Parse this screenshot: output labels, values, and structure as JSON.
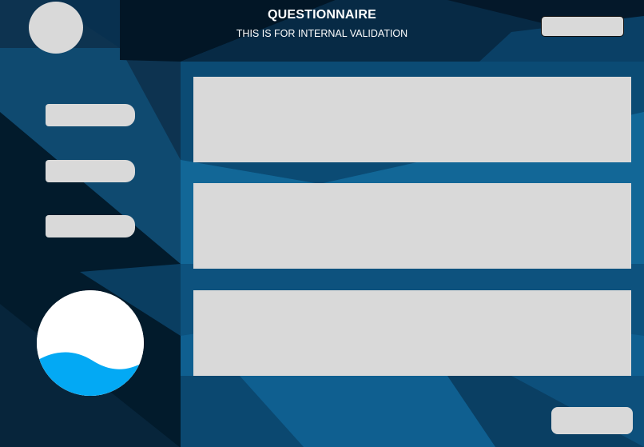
{
  "header": {
    "title": "QUESTIONNAIRE",
    "subtitle": "THIS IS FOR INTERNAL VALIDATION"
  },
  "colors": {
    "background_dark": "#041c2e",
    "panel_blue": "#0f5c8c",
    "placeholder_gray": "#d9d9d9",
    "logo_water": "#03a9f4"
  }
}
